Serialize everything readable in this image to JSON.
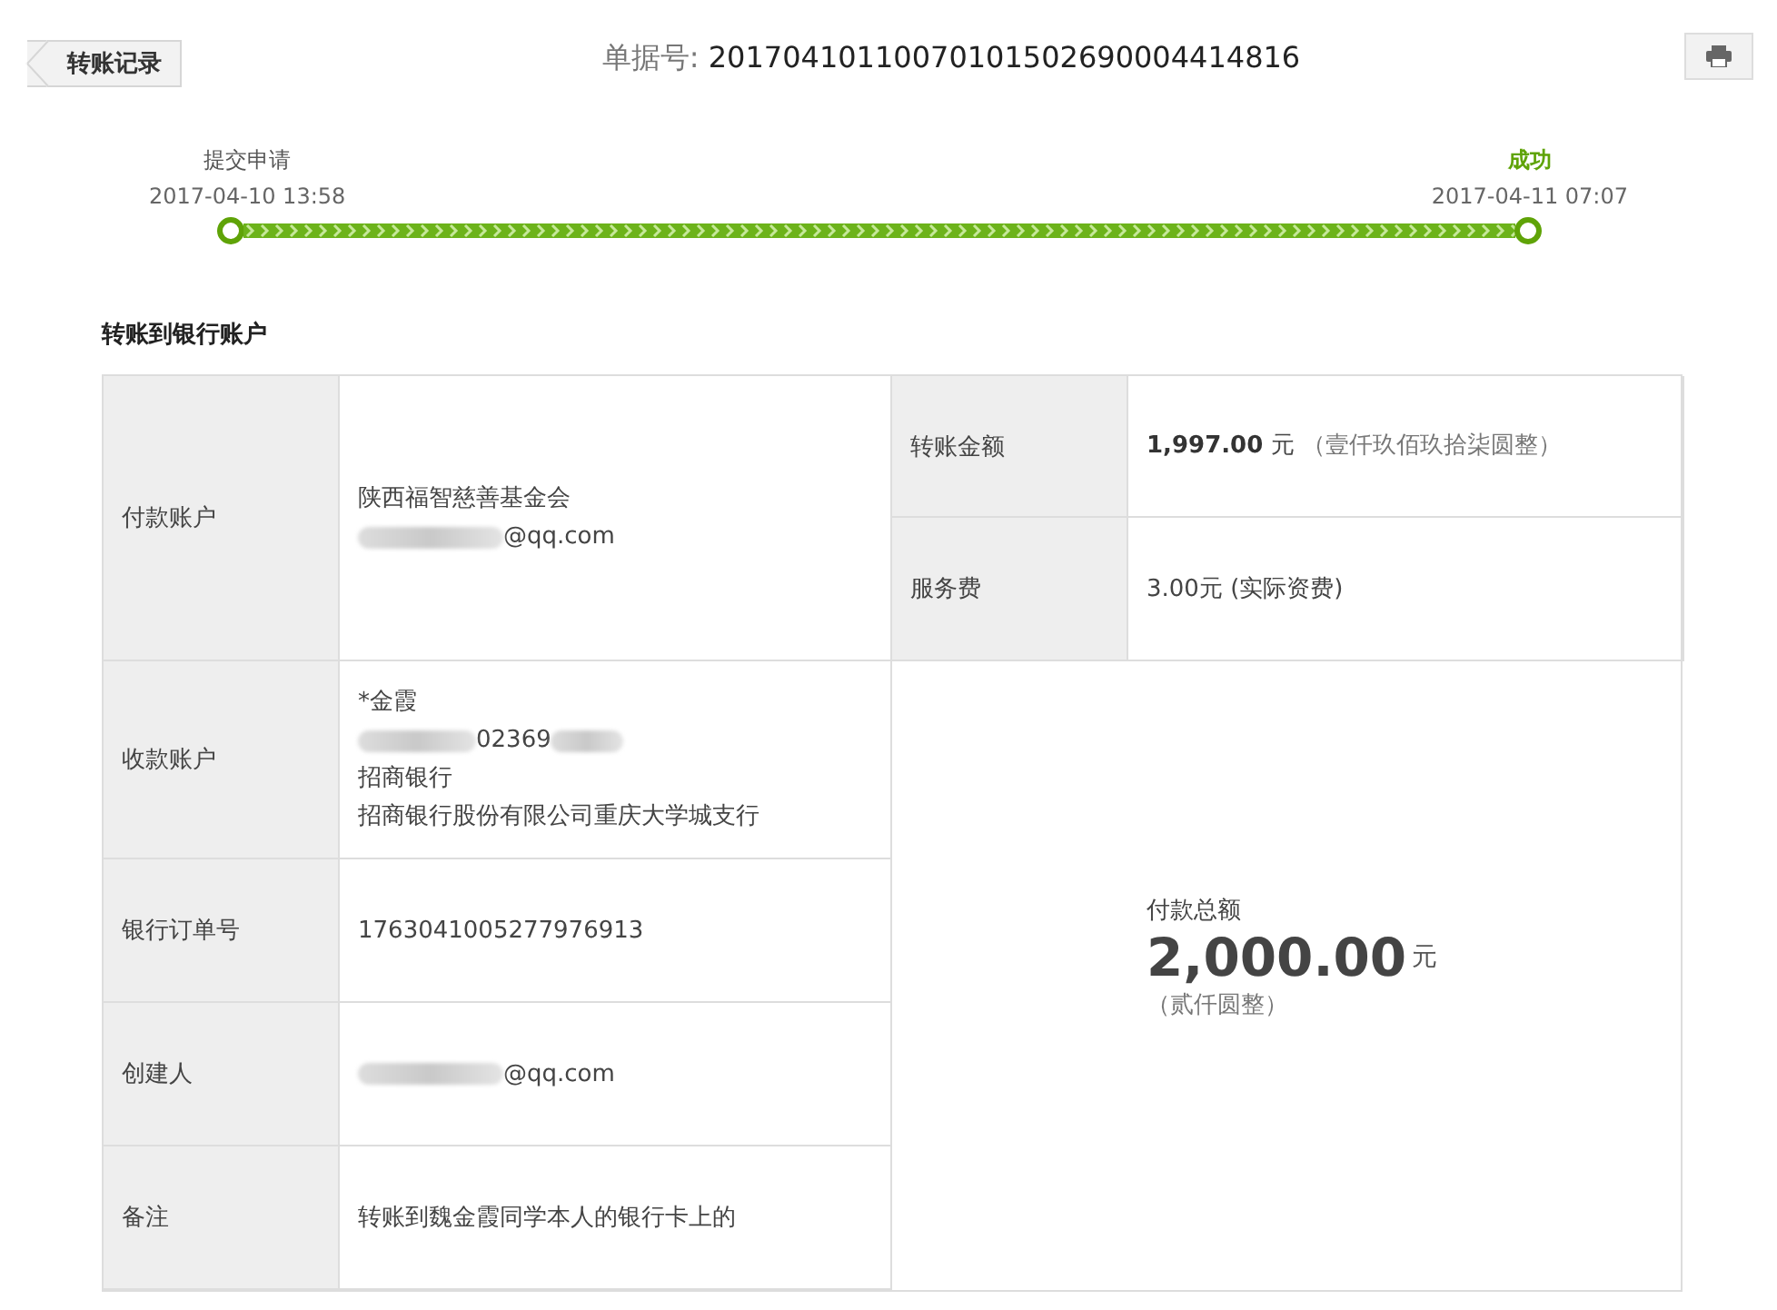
{
  "header": {
    "back_button": "转账记录",
    "receipt_label": "单据号:",
    "receipt_number": "20170410110070101502690004414816"
  },
  "timeline": {
    "level": 1,
    "steps": [
      {
        "label": "提交申请",
        "time": "2017-04-10 13:58",
        "kind": "start"
      },
      {
        "label": "成功",
        "time": "2017-04-11 07:07",
        "kind": "success"
      }
    ]
  },
  "section_title": "转账到银行账户",
  "left_rows": [
    {
      "label": "付款账户",
      "lines": [
        {
          "text": "陕西福智慈善基金会"
        },
        {
          "text": "@qq.com",
          "redacted_before": true,
          "redacted_after": false
        }
      ]
    },
    {
      "label": "收款账户",
      "lines": [
        {
          "text": "*金霞"
        },
        {
          "text": "02369",
          "redacted_before": true,
          "redacted_after": true
        },
        {
          "text": "招商银行"
        },
        {
          "text": "招商银行股份有限公司重庆大学城支行"
        }
      ]
    },
    {
      "label": "银行订单号",
      "lines": [
        {
          "text": "1763041005277976913"
        }
      ]
    },
    {
      "label": "创建人",
      "lines": [
        {
          "text": "@qq.com",
          "redacted_before": true,
          "redacted_after": false
        }
      ]
    },
    {
      "label": "备注",
      "lines": [
        {
          "text": "转账到魏金霞同学本人的银行卡上的"
        }
      ]
    }
  ],
  "transfer_amount": {
    "label": "转账金额",
    "amount": "1,997.00",
    "unit": "元",
    "words": "（壹仟玖佰玖拾柒圆整）"
  },
  "service_fee": {
    "label": "服务费",
    "value": "3.00元 (实际资费)"
  },
  "total": {
    "label": "付款总额",
    "amount": "2,000.00",
    "unit": "元",
    "words": "（贰仟圆整）"
  }
}
